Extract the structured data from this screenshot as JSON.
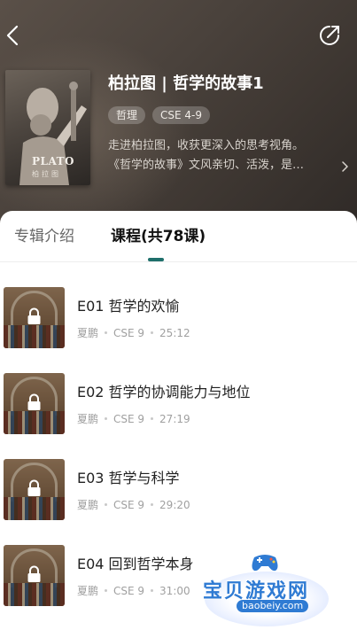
{
  "header": {
    "album_title": "柏拉图 | 哲学的故事1",
    "tags": [
      "哲理",
      "CSE 4-9"
    ],
    "description_lines": [
      "走进柏拉图，收获更深入的思考视角。",
      "《哲学的故事》文风亲切、活泼，是…"
    ]
  },
  "cover": {
    "title": "PLATO",
    "subtitle": "柏拉图"
  },
  "tabs": [
    {
      "label": "专辑介绍",
      "active": false
    },
    {
      "label": "课程(共78课)",
      "active": true
    }
  ],
  "lessons": [
    {
      "title": "E01 哲学的欢愉",
      "author": "夏鹏",
      "level": "CSE 9",
      "duration": "25:12",
      "locked": true
    },
    {
      "title": "E02 哲学的协调能力与地位",
      "author": "夏鹏",
      "level": "CSE 9",
      "duration": "27:19",
      "locked": true
    },
    {
      "title": "E03 哲学与科学",
      "author": "夏鹏",
      "level": "CSE 9",
      "duration": "29:20",
      "locked": true
    },
    {
      "title": "E04 回到哲学本身",
      "author": "夏鹏",
      "level": "CSE 9",
      "duration": "31:00",
      "locked": true
    }
  ],
  "watermark": {
    "text": "宝贝游戏网",
    "url": "baobeiy.com"
  },
  "colors": {
    "accent": "#1f6f6b",
    "hero_bg": "#4a423c",
    "watermark_blue": "#2f7bd3"
  },
  "icons": {
    "back": "chevron-left-icon",
    "share": "share-icon",
    "lock": "lock-icon",
    "more": "chevron-right-icon"
  }
}
